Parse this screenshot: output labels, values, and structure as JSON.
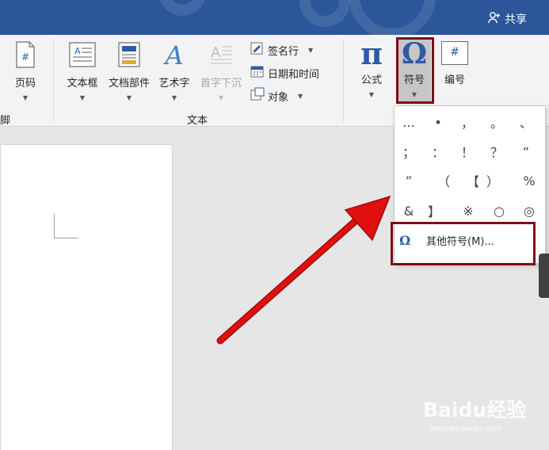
{
  "share": {
    "label": "共享",
    "icon": "add-person-icon"
  },
  "ribbon": {
    "header_footer_group": {
      "page_number_label": "页码",
      "page_number_icon": "page-number-icon",
      "group_label": "脚"
    },
    "text_group": {
      "textbox_label": "文本框",
      "textbox_icon": "textbox-icon",
      "quick_parts_label": "文档部件",
      "quick_parts_icon": "document-parts-icon",
      "wordart_label": "艺术字",
      "wordart_icon": "wordart-icon",
      "dropcap_label": "首字下沉",
      "dropcap_icon": "drop-cap-icon",
      "signature_line_label": "签名行",
      "signature_line_icon": "signature-line-icon",
      "date_time_label": "日期和时间",
      "date_time_icon": "calendar-icon",
      "object_label": "对象",
      "object_icon": "object-icon",
      "group_label": "文本"
    },
    "symbols_group": {
      "equation_label": "公式",
      "equation_glyph": "π",
      "symbol_label": "符号",
      "symbol_glyph": "Ω",
      "numbering_label": "编号",
      "numbering_glyph": "#"
    }
  },
  "symbol_menu": {
    "symbols": [
      "…",
      "•",
      "，",
      "。",
      "、",
      "；",
      "：",
      "！",
      "？",
      "“",
      "”",
      "（",
      "【",
      "）",
      "%",
      "&",
      "】",
      "※",
      "○",
      "◎"
    ],
    "more_symbols_icon": "Ω",
    "more_symbols_label": "其他符号(M)..."
  },
  "watermark": {
    "brand": "Baidu经验",
    "url": "jingyan.baidu.com"
  },
  "colors": {
    "titlebar": "#2b579a",
    "highlight": "#7a0f16",
    "arrow": "#e01010",
    "accent_blue": "#2e5aa8"
  }
}
